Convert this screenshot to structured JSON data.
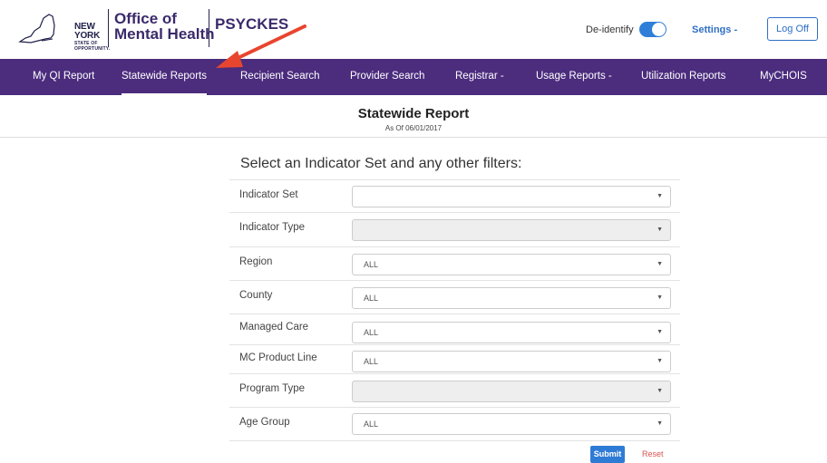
{
  "header": {
    "state_logo_line1": "NEW YORK",
    "state_logo_line2": "STATE OF",
    "state_logo_line3": "OPPORTUNITY.",
    "agency_line1": "Office of",
    "agency_line2": "Mental Health",
    "app_name": "PSYCKES",
    "deidentify_label": "De-identify",
    "deidentify_on": true,
    "settings_label": "Settings -",
    "logoff_label": "Log Off"
  },
  "nav": {
    "items": [
      {
        "label": "My QI Report"
      },
      {
        "label": "Statewide Reports",
        "active": true
      },
      {
        "label": "Recipient Search"
      },
      {
        "label": "Provider Search"
      },
      {
        "label": "Registrar -"
      },
      {
        "label": "Usage Reports -"
      },
      {
        "label": "Utilization Reports"
      },
      {
        "label": "MyCHOIS"
      }
    ]
  },
  "page": {
    "title": "Statewide Report",
    "as_of": "As Of 06/01/2017"
  },
  "form": {
    "heading": "Select an Indicator Set and any other filters:",
    "fields": [
      {
        "label": "Indicator Set",
        "value": "",
        "disabled": false
      },
      {
        "label": "Indicator Type",
        "value": "",
        "disabled": true
      },
      {
        "label": "Region",
        "value": "ALL",
        "disabled": false
      },
      {
        "label": "County",
        "value": "ALL",
        "disabled": false
      },
      {
        "label": "Managed Care",
        "value": "ALL",
        "disabled": false
      },
      {
        "label": "MC Product Line",
        "value": "ALL",
        "disabled": false
      },
      {
        "label": "Program Type",
        "value": "",
        "disabled": true
      },
      {
        "label": "Age Group",
        "value": "ALL",
        "disabled": false
      }
    ],
    "submit_label": "Submit",
    "reset_label": "Reset"
  },
  "colors": {
    "nav_bg": "#4b2c7d",
    "accent_blue": "#2e7bd6",
    "annotation_arrow": "#e8452f",
    "reset_red": "#d9534f"
  }
}
